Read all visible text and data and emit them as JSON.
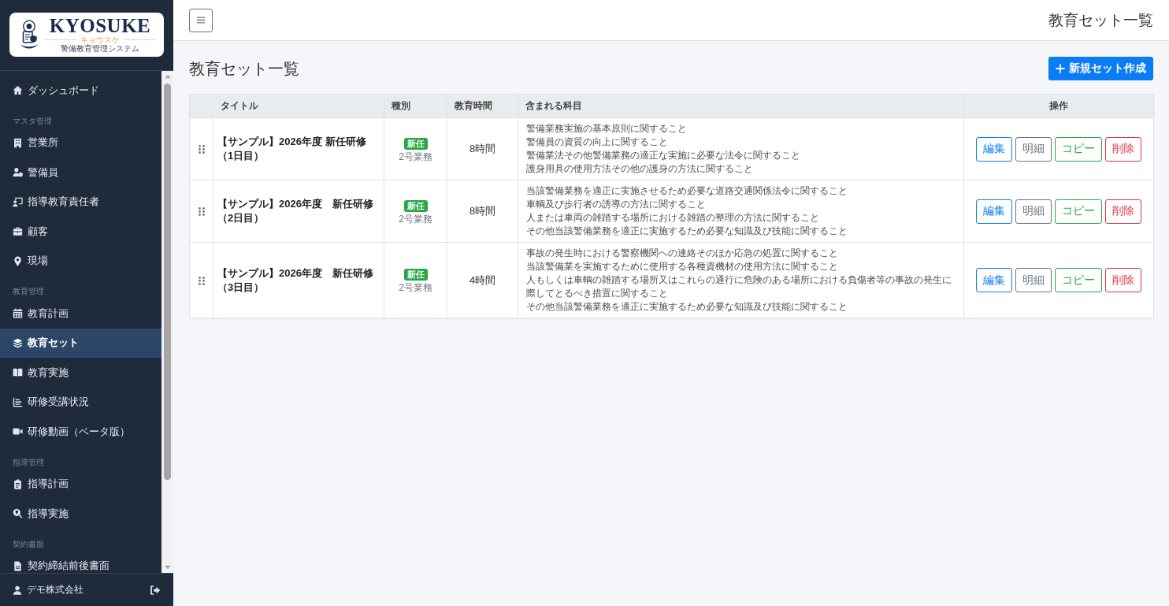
{
  "sidebar": {
    "logo": {
      "wordmark": "KYOSUKE",
      "reading": "キョウスケ",
      "tagline": "警備教育管理システム"
    },
    "groups": [
      {
        "items": [
          {
            "label": "ダッシュボード",
            "selected": false
          }
        ]
      },
      {
        "heading": "マスタ管理",
        "items": [
          {
            "label": "営業所",
            "selected": false
          },
          {
            "label": "警備員",
            "selected": false
          },
          {
            "label": "指導教育責任者",
            "selected": false
          },
          {
            "label": "顧客",
            "selected": false
          },
          {
            "label": "現場",
            "selected": false
          }
        ]
      },
      {
        "heading": "教育管理",
        "items": [
          {
            "label": "教育計画",
            "selected": false
          },
          {
            "label": "教育セット",
            "selected": true
          },
          {
            "label": "教育実施",
            "selected": false
          },
          {
            "label": "研修受講状況",
            "selected": false
          },
          {
            "label": "研修動画（ベータ版）",
            "selected": false
          }
        ]
      },
      {
        "heading": "指導管理",
        "items": [
          {
            "label": "指導計画",
            "selected": false
          },
          {
            "label": "指導実施",
            "selected": false
          }
        ]
      },
      {
        "heading": "契約書面",
        "items": [
          {
            "label": "契約締結前後書面",
            "selected": false
          }
        ]
      }
    ],
    "user": {
      "name": "デモ株式会社"
    }
  },
  "header": {
    "title": "教育セット一覧"
  },
  "page": {
    "heading": "教育セット一覧",
    "new_button": "新規セット作成"
  },
  "table": {
    "columns": [
      {
        "label": "タイトル"
      },
      {
        "label": "種別"
      },
      {
        "label": "教育時間"
      },
      {
        "label": "含まれる科目"
      },
      {
        "label": "操作"
      }
    ],
    "rows": [
      {
        "title": "【サンプル】2026年度 新任研修（1日目）",
        "badge": "新任",
        "category": "2号業務",
        "hours": "8時間",
        "subjects": [
          "警備業務実施の基本原則に関すること",
          "警備員の資質の向上に関すること",
          "警備業法その他警備業務の適正な実施に必要な法令に関すること",
          "護身用具の使用方法その他の護身の方法に関すること"
        ],
        "actions": [
          {
            "kind": "edit",
            "label": "編集"
          },
          {
            "kind": "detail",
            "label": "明細"
          },
          {
            "kind": "copy",
            "label": "コピー"
          },
          {
            "kind": "delete",
            "label": "削除"
          }
        ]
      },
      {
        "title": "【サンプル】2026年度　新任研修（2日目）",
        "badge": "新任",
        "category": "2号業務",
        "hours": "8時間",
        "subjects": [
          "当該警備業務を適正に実施させるため必要な道路交通関係法令に関すること",
          "車輌及び歩行者の誘導の方法に関すること",
          "人または車両の雑踏する場所における雑踏の整理の方法に関すること",
          "その他当該警備業務を適正に実施するため必要な知識及び技能に関すること"
        ],
        "actions": [
          {
            "kind": "edit",
            "label": "編集"
          },
          {
            "kind": "detail",
            "label": "明細"
          },
          {
            "kind": "copy",
            "label": "コピー"
          },
          {
            "kind": "delete",
            "label": "削除"
          }
        ]
      },
      {
        "title": "【サンプル】2026年度　新任研修（3日目）",
        "badge": "新任",
        "category": "2号業務",
        "hours": "4時間",
        "subjects": [
          "事故の発生時における警察機関への連絡そのほか応急の処置に関すること",
          "当該警備業を実施するために使用する各種資機材の使用方法に関すること",
          "人もしくは車輌の雑踏する場所又はこれらの通行に危険のある場所における負傷者等の事故の発生に際してとるべき措置に関すること",
          "その他当該警備業務を適正に実施するため必要な知識及び技能に関すること"
        ],
        "actions": [
          {
            "kind": "edit",
            "label": "編集"
          },
          {
            "kind": "detail",
            "label": "明細"
          },
          {
            "kind": "copy",
            "label": "コピー"
          },
          {
            "kind": "delete",
            "label": "削除"
          }
        ]
      }
    ]
  }
}
